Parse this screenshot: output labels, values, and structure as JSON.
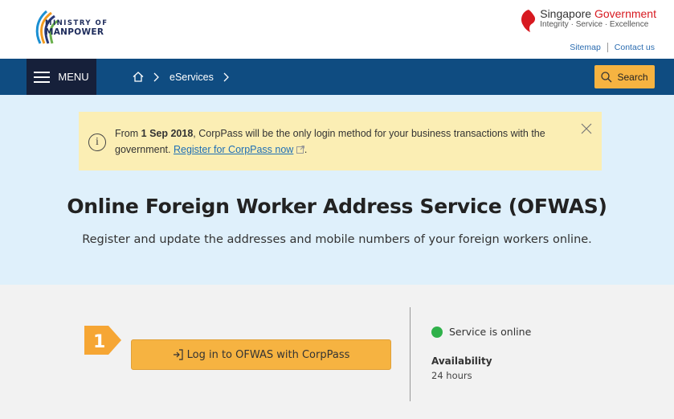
{
  "header": {
    "logo_line1": "MINISTRY OF",
    "logo_line2": "MANPOWER",
    "gov_title_prefix": "Singapore",
    "gov_title_suffix": "Government",
    "gov_tagline": "Integrity · Service · Excellence",
    "links": [
      {
        "label": "Sitemap"
      },
      {
        "label": "Contact us"
      }
    ]
  },
  "nav": {
    "menu_label": "MENU",
    "breadcrumb": [
      {
        "label": "eServices"
      }
    ],
    "search_label": "Search"
  },
  "notice": {
    "text_prefix": "From ",
    "text_bold": "1 Sep 2018",
    "text_middle": ", CorpPass will be the only login method for your business transactions with the government. ",
    "link_label": "Register for CorpPass now",
    "text_suffix": "."
  },
  "hero": {
    "title": "Online Foreign Worker Address Service (OFWAS)",
    "subtitle": "Register and update the addresses and mobile numbers of your foreign workers online."
  },
  "service": {
    "step_number": "1",
    "login_label": "Log in to OFWAS with CorpPass",
    "status_text": "Service is online",
    "availability_label": "Availability",
    "availability_value": "24 hours"
  },
  "colors": {
    "navbar": "#0f4c81",
    "menu_bg": "#16203a",
    "accent": "#f6b341",
    "hero_bg": "#dff0fb",
    "notice_bg": "#fbeeb4",
    "status_online": "#2fb14a"
  },
  "icons": [
    "mom-logo-icon",
    "lion-head-icon",
    "hamburger-icon",
    "home-icon",
    "chevron-right-icon",
    "search-icon",
    "info-icon",
    "close-icon",
    "external-link-icon",
    "login-icon",
    "status-dot-icon",
    "step-arrow-icon"
  ]
}
